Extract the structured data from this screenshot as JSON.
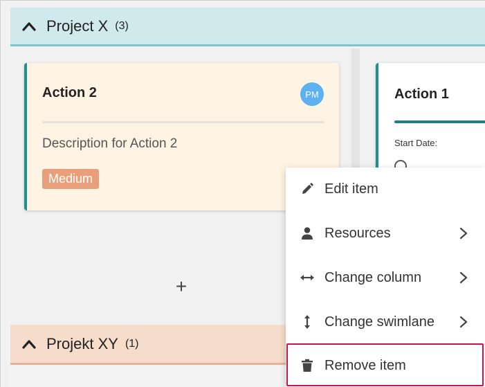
{
  "swimlanes": [
    {
      "title": "Project X",
      "count": "(3)",
      "icon": "chevron-up-icon"
    },
    {
      "title": "Projekt XY",
      "count": "(1)",
      "icon": "chevron-up-icon"
    }
  ],
  "cards": {
    "action2": {
      "title": "Action 2",
      "avatar": "PM",
      "description": "Description for Action 2",
      "priority": "Medium"
    },
    "action1": {
      "title": "Action 1",
      "start_date_label": "Start Date:"
    }
  },
  "add_button": {
    "label": "+"
  },
  "context_menu": {
    "items": [
      {
        "label": "Edit item",
        "icon": "pencil-icon",
        "submenu": false
      },
      {
        "label": "Resources",
        "icon": "person-icon",
        "submenu": true
      },
      {
        "label": "Change column",
        "icon": "horizontal-arrows-icon",
        "submenu": true
      },
      {
        "label": "Change swimlane",
        "icon": "vertical-arrows-icon",
        "submenu": true
      },
      {
        "label": "Remove item",
        "icon": "trash-icon",
        "submenu": false
      }
    ]
  },
  "colors": {
    "lane_x_header": "#cfe9ec",
    "lane_xy_header": "#f6dccb",
    "card_accent": "#1f8f8f",
    "priority_medium": "#e9a07a",
    "avatar": "#5db1f1",
    "highlight": "#c8134e"
  }
}
